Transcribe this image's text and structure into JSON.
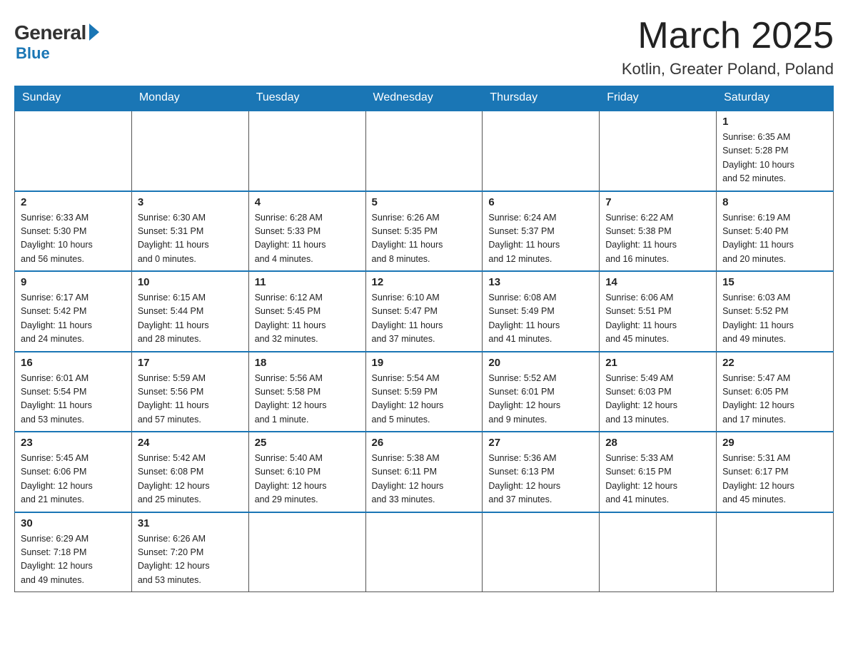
{
  "logo": {
    "general": "General",
    "blue": "Blue"
  },
  "title": {
    "month": "March 2025",
    "location": "Kotlin, Greater Poland, Poland"
  },
  "weekdays": [
    "Sunday",
    "Monday",
    "Tuesday",
    "Wednesday",
    "Thursday",
    "Friday",
    "Saturday"
  ],
  "weeks": [
    [
      {
        "day": "",
        "info": ""
      },
      {
        "day": "",
        "info": ""
      },
      {
        "day": "",
        "info": ""
      },
      {
        "day": "",
        "info": ""
      },
      {
        "day": "",
        "info": ""
      },
      {
        "day": "",
        "info": ""
      },
      {
        "day": "1",
        "info": "Sunrise: 6:35 AM\nSunset: 5:28 PM\nDaylight: 10 hours\nand 52 minutes."
      }
    ],
    [
      {
        "day": "2",
        "info": "Sunrise: 6:33 AM\nSunset: 5:30 PM\nDaylight: 10 hours\nand 56 minutes."
      },
      {
        "day": "3",
        "info": "Sunrise: 6:30 AM\nSunset: 5:31 PM\nDaylight: 11 hours\nand 0 minutes."
      },
      {
        "day": "4",
        "info": "Sunrise: 6:28 AM\nSunset: 5:33 PM\nDaylight: 11 hours\nand 4 minutes."
      },
      {
        "day": "5",
        "info": "Sunrise: 6:26 AM\nSunset: 5:35 PM\nDaylight: 11 hours\nand 8 minutes."
      },
      {
        "day": "6",
        "info": "Sunrise: 6:24 AM\nSunset: 5:37 PM\nDaylight: 11 hours\nand 12 minutes."
      },
      {
        "day": "7",
        "info": "Sunrise: 6:22 AM\nSunset: 5:38 PM\nDaylight: 11 hours\nand 16 minutes."
      },
      {
        "day": "8",
        "info": "Sunrise: 6:19 AM\nSunset: 5:40 PM\nDaylight: 11 hours\nand 20 minutes."
      }
    ],
    [
      {
        "day": "9",
        "info": "Sunrise: 6:17 AM\nSunset: 5:42 PM\nDaylight: 11 hours\nand 24 minutes."
      },
      {
        "day": "10",
        "info": "Sunrise: 6:15 AM\nSunset: 5:44 PM\nDaylight: 11 hours\nand 28 minutes."
      },
      {
        "day": "11",
        "info": "Sunrise: 6:12 AM\nSunset: 5:45 PM\nDaylight: 11 hours\nand 32 minutes."
      },
      {
        "day": "12",
        "info": "Sunrise: 6:10 AM\nSunset: 5:47 PM\nDaylight: 11 hours\nand 37 minutes."
      },
      {
        "day": "13",
        "info": "Sunrise: 6:08 AM\nSunset: 5:49 PM\nDaylight: 11 hours\nand 41 minutes."
      },
      {
        "day": "14",
        "info": "Sunrise: 6:06 AM\nSunset: 5:51 PM\nDaylight: 11 hours\nand 45 minutes."
      },
      {
        "day": "15",
        "info": "Sunrise: 6:03 AM\nSunset: 5:52 PM\nDaylight: 11 hours\nand 49 minutes."
      }
    ],
    [
      {
        "day": "16",
        "info": "Sunrise: 6:01 AM\nSunset: 5:54 PM\nDaylight: 11 hours\nand 53 minutes."
      },
      {
        "day": "17",
        "info": "Sunrise: 5:59 AM\nSunset: 5:56 PM\nDaylight: 11 hours\nand 57 minutes."
      },
      {
        "day": "18",
        "info": "Sunrise: 5:56 AM\nSunset: 5:58 PM\nDaylight: 12 hours\nand 1 minute."
      },
      {
        "day": "19",
        "info": "Sunrise: 5:54 AM\nSunset: 5:59 PM\nDaylight: 12 hours\nand 5 minutes."
      },
      {
        "day": "20",
        "info": "Sunrise: 5:52 AM\nSunset: 6:01 PM\nDaylight: 12 hours\nand 9 minutes."
      },
      {
        "day": "21",
        "info": "Sunrise: 5:49 AM\nSunset: 6:03 PM\nDaylight: 12 hours\nand 13 minutes."
      },
      {
        "day": "22",
        "info": "Sunrise: 5:47 AM\nSunset: 6:05 PM\nDaylight: 12 hours\nand 17 minutes."
      }
    ],
    [
      {
        "day": "23",
        "info": "Sunrise: 5:45 AM\nSunset: 6:06 PM\nDaylight: 12 hours\nand 21 minutes."
      },
      {
        "day": "24",
        "info": "Sunrise: 5:42 AM\nSunset: 6:08 PM\nDaylight: 12 hours\nand 25 minutes."
      },
      {
        "day": "25",
        "info": "Sunrise: 5:40 AM\nSunset: 6:10 PM\nDaylight: 12 hours\nand 29 minutes."
      },
      {
        "day": "26",
        "info": "Sunrise: 5:38 AM\nSunset: 6:11 PM\nDaylight: 12 hours\nand 33 minutes."
      },
      {
        "day": "27",
        "info": "Sunrise: 5:36 AM\nSunset: 6:13 PM\nDaylight: 12 hours\nand 37 minutes."
      },
      {
        "day": "28",
        "info": "Sunrise: 5:33 AM\nSunset: 6:15 PM\nDaylight: 12 hours\nand 41 minutes."
      },
      {
        "day": "29",
        "info": "Sunrise: 5:31 AM\nSunset: 6:17 PM\nDaylight: 12 hours\nand 45 minutes."
      }
    ],
    [
      {
        "day": "30",
        "info": "Sunrise: 6:29 AM\nSunset: 7:18 PM\nDaylight: 12 hours\nand 49 minutes."
      },
      {
        "day": "31",
        "info": "Sunrise: 6:26 AM\nSunset: 7:20 PM\nDaylight: 12 hours\nand 53 minutes."
      },
      {
        "day": "",
        "info": ""
      },
      {
        "day": "",
        "info": ""
      },
      {
        "day": "",
        "info": ""
      },
      {
        "day": "",
        "info": ""
      },
      {
        "day": "",
        "info": ""
      }
    ]
  ]
}
